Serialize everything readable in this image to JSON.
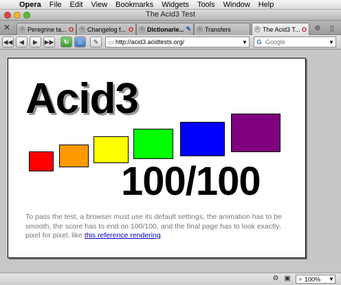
{
  "menubar": {
    "apple": "",
    "app": "Opera",
    "items": [
      "File",
      "Edit",
      "View",
      "Bookmarks",
      "Widgets",
      "Tools",
      "Window",
      "Help"
    ]
  },
  "window": {
    "title": "The Acid3 Test"
  },
  "tabs": [
    {
      "label": "Peregrine ta...",
      "fav": "O",
      "fav_kind": "opera",
      "bold": false,
      "active": false
    },
    {
      "label": "Changelog f...",
      "fav": "O",
      "fav_kind": "opera",
      "bold": false,
      "active": false
    },
    {
      "label": "Dictionarie...",
      "fav": "✎",
      "fav_kind": "dl",
      "bold": true,
      "active": false
    },
    {
      "label": "Transfers",
      "fav": "",
      "fav_kind": "",
      "bold": false,
      "active": false
    },
    {
      "label": "The Acid3 T...",
      "fav": "O",
      "fav_kind": "opera",
      "bold": false,
      "active": true
    }
  ],
  "navbar": {
    "url": "http://acid3.acidtests.org/",
    "search_placeholder": "Google"
  },
  "page": {
    "heading": "Acid3",
    "score": "100/100",
    "description": "To pass the test, a browser must use its default settings, the animation has to be smooth, the score has to end on 100/100, and the final page has to look exactly, pixel for pixel, like ",
    "link_text": "this reference rendering",
    "description_end": "."
  },
  "color_boxes": [
    {
      "name": "red-box",
      "color": "#ff0000"
    },
    {
      "name": "orange-box",
      "color": "#ff9900"
    },
    {
      "name": "yellow-box",
      "color": "#ffff00"
    },
    {
      "name": "green-box",
      "color": "#00ff00"
    },
    {
      "name": "blue-box",
      "color": "#0000ff"
    },
    {
      "name": "purple-box",
      "color": "#7f007f"
    }
  ],
  "statusbar": {
    "zoom": "100%"
  }
}
